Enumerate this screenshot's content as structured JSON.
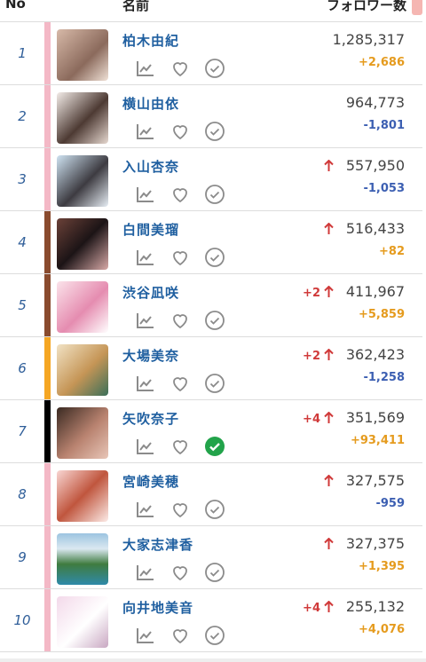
{
  "header": {
    "no_label": "No",
    "name_label": "名前",
    "followers_label": "フォロワー数"
  },
  "rows": [
    {
      "rank": "1",
      "name": "柏木由紀",
      "followers": "1,285,317",
      "delta": "+2,686",
      "delta_type": "plus",
      "trend_arrow": false,
      "trend_change": "",
      "bar_color": "#f4b8c6",
      "avatar_bg": "linear-gradient(135deg,#d7b9a8,#8b6a5c 60%,#f0e1d6)",
      "checked": false
    },
    {
      "rank": "2",
      "name": "横山由依",
      "followers": "964,773",
      "delta": "-1,801",
      "delta_type": "minus",
      "trend_arrow": false,
      "trend_change": "",
      "bar_color": "#f4b8c6",
      "avatar_bg": "linear-gradient(135deg,#f3ece8,#4d3a33 55%,#e6d8d0)",
      "checked": false
    },
    {
      "rank": "3",
      "name": "入山杏奈",
      "followers": "557,950",
      "delta": "-1,053",
      "delta_type": "minus",
      "trend_arrow": true,
      "trend_change": "",
      "bar_color": "#f4b8c6",
      "avatar_bg": "linear-gradient(135deg,#cfe3f2,#3d3b41 55%,#e7eef5)",
      "checked": false
    },
    {
      "rank": "4",
      "name": "白間美瑠",
      "followers": "516,433",
      "delta": "+82",
      "delta_type": "plus",
      "trend_arrow": true,
      "trend_change": "",
      "bar_color": "#8a4b2e",
      "avatar_bg": "linear-gradient(135deg,#6b4138,#1c1416 50%,#d8a9a7)",
      "checked": false
    },
    {
      "rank": "5",
      "name": "渋谷凪咲",
      "followers": "411,967",
      "delta": "+5,859",
      "delta_type": "plus",
      "trend_arrow": true,
      "trend_change": "+2",
      "bar_color": "#8a4b2e",
      "avatar_bg": "linear-gradient(135deg,#fbe3ea,#e58cb0 55%,#fff)",
      "checked": false
    },
    {
      "rank": "6",
      "name": "大場美奈",
      "followers": "362,423",
      "delta": "-1,258",
      "delta_type": "minus",
      "trend_arrow": true,
      "trend_change": "+2",
      "bar_color": "#f5a623",
      "avatar_bg": "linear-gradient(135deg,#f1e2c4,#c59556 55%,#3b6f59)",
      "checked": false
    },
    {
      "rank": "7",
      "name": "矢吹奈子",
      "followers": "351,569",
      "delta": "+93,411",
      "delta_type": "plus",
      "trend_arrow": true,
      "trend_change": "+4",
      "bar_color": "#000000",
      "avatar_bg": "linear-gradient(135deg,#3a2a22,#b98370 55%,#e8c6b8)",
      "checked": true
    },
    {
      "rank": "8",
      "name": "宮崎美穂",
      "followers": "327,575",
      "delta": "-959",
      "delta_type": "minus",
      "trend_arrow": true,
      "trend_change": "",
      "bar_color": "#f4b8c6",
      "avatar_bg": "linear-gradient(135deg,#f9d6d3,#c0563e 50%,#fcebe7)",
      "checked": false
    },
    {
      "rank": "9",
      "name": "大家志津香",
      "followers": "327,375",
      "delta": "+1,395",
      "delta_type": "plus",
      "trend_arrow": true,
      "trend_change": "",
      "bar_color": "#f4b8c6",
      "avatar_bg": "linear-gradient(180deg,#9cc4e0 0%,#dbe8f1 30%,#3f7b3f 60%,#2f8aa9 100%)",
      "checked": false
    },
    {
      "rank": "10",
      "name": "向井地美音",
      "followers": "255,132",
      "delta": "+4,076",
      "delta_type": "plus",
      "trend_arrow": true,
      "trend_change": "+4",
      "bar_color": "#f4b8c6",
      "avatar_bg": "linear-gradient(135deg,#f3d9ea,#ffffff 55%,#c9a8c2)",
      "checked": false
    }
  ],
  "colors": {
    "link": "#1f5fa0",
    "plus": "#e59b1e",
    "minus": "#3c5fb2",
    "up": "#d03a3a",
    "check_active": "#22a34a",
    "icon_gray": "#8b8b8b"
  },
  "icons": {
    "chart": "trend-chart-icon",
    "heart": "heart-icon",
    "check": "check-circle-icon",
    "up": "arrow-up-icon"
  }
}
